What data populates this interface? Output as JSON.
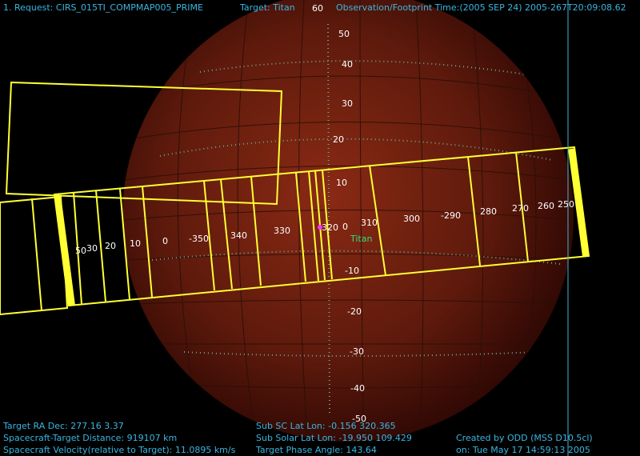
{
  "header": {
    "request_label": "1. Request:",
    "request_value": "CIRS_015TI_COMPMAP005_PRIME",
    "target_label": "Target:",
    "target_value": "Titan",
    "obs_label": "Observation/Footprint Time:",
    "obs_value": "(2005 SEP 24) 2005-267T20:09:08.62"
  },
  "body_label": "Titan",
  "lat_labels": [
    "60",
    "50",
    "40",
    "30",
    "20",
    "10",
    "0",
    "-10",
    "-20",
    "-30",
    "-40",
    "-50"
  ],
  "lon_labels": [
    "50",
    "30",
    "20",
    "10",
    "0",
    "-350",
    "340",
    "330",
    "320",
    "310",
    "300",
    "-290",
    "280",
    "270",
    "260",
    "250"
  ],
  "footer": {
    "ra_dec_label": "Target RA  Dec:",
    "ra_dec_value": "277.16    3.37",
    "distance_label": "Spacecraft-Target Distance:",
    "distance_value": "919107 km",
    "velocity_label": "Spacecraft Velocity(relative to Target):",
    "velocity_value": "11.0895 km/s",
    "sub_sc_label": "Sub SC Lat Lon:",
    "sub_sc_value": "-0.156   320.365",
    "sub_solar_label": "Sub Solar Lat Lon:",
    "sub_solar_value": "-19.950   109.429",
    "phase_label": "Target Phase Angle:",
    "phase_value": "143.64",
    "created_label": "Created by ODD",
    "created_value": "(MSS D10.5cl)",
    "created_on_label": "on:",
    "created_on_value": "Tue May 17 14:59:13 2005"
  },
  "colors": {
    "footprint": "#ffff33",
    "text": "#3ab6e0",
    "target_marker": "#ff33ff"
  }
}
